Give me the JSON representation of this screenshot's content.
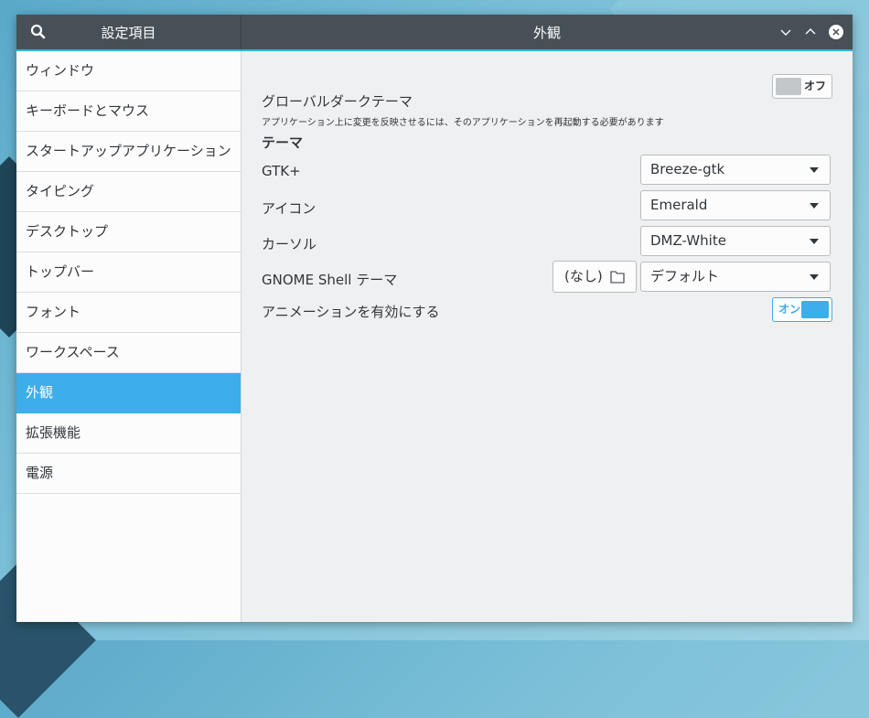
{
  "header": {
    "left_title": "設定項目",
    "right_title": "外観"
  },
  "sidebar": {
    "items": [
      {
        "label": "ウィンドウ"
      },
      {
        "label": "キーボードとマウス"
      },
      {
        "label": "スタートアップアプリケーション"
      },
      {
        "label": "タイピング"
      },
      {
        "label": "デスクトップ"
      },
      {
        "label": "トップバー"
      },
      {
        "label": "フォント"
      },
      {
        "label": "ワークスペース"
      },
      {
        "label": "外観"
      },
      {
        "label": "拡張機能"
      },
      {
        "label": "電源"
      }
    ],
    "active": "外観"
  },
  "content": {
    "dark_theme": {
      "label": "グローバルダークテーマ",
      "sublabel": "アプリケーション上に変更を反映させるには、そのアプリケーションを再起動する必要があります",
      "switch_text": "オフ",
      "state": "off"
    },
    "theme_section": "テーマ",
    "gtk": {
      "label": "GTK+",
      "value": "Breeze-gtk"
    },
    "icons": {
      "label": "アイコン",
      "value": "Emerald"
    },
    "cursor": {
      "label": "カーソル",
      "value": "DMZ-White"
    },
    "shell": {
      "label": "GNOME Shell テーマ",
      "file_value": "(なし)",
      "value": "デフォルト"
    },
    "animations": {
      "label": "アニメーションを有効にする",
      "switch_text": "オン",
      "state": "on"
    }
  },
  "icons": {
    "search": "search-icon",
    "minimize": "chevron-down-icon",
    "maximize": "chevron-up-icon",
    "close": "close-icon",
    "folder": "folder-icon"
  },
  "colors": {
    "accent": "#3daee9",
    "titlebar": "#475057",
    "window_bg": "#eff0f1"
  }
}
